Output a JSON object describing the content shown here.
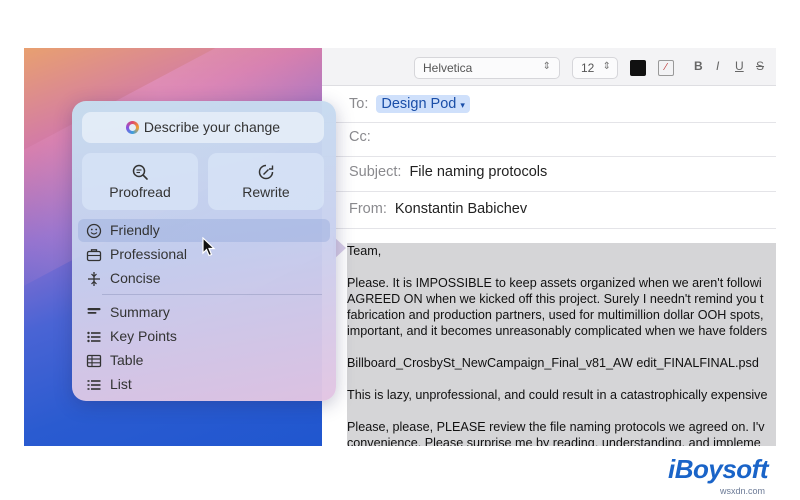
{
  "toolbar": {
    "font": "Helvetica",
    "size": "12",
    "bold": "B",
    "italic": "I",
    "underline": "U",
    "strike": "S",
    "text_color": "#111111"
  },
  "mail": {
    "to_label": "To:",
    "to_value": "Design Pod",
    "cc_label": "Cc:",
    "subject_label": "Subject:",
    "subject_value": "File naming protocols",
    "from_label": "From:",
    "from_value": "Konstantin Babichev",
    "body": [
      "Team,",
      "Please. It is IMPOSSIBLE to keep assets organized when we aren't followi",
      "AGREED ON when we kicked off this project. Surely I needn't remind you t",
      "fabrication and production partners, used for multimillion dollar OOH spots,",
      "important, and it becomes unreasonably complicated when we have folders",
      "Billboard_CrosbySt_NewCampaign_Final_v81_AW edit_FINALFINAL.psd",
      "This is lazy, unprofessional, and could result in a catastrophically expensive",
      "Please, please, PLEASE review the file naming protocols we agreed on. I'v",
      "convenience. Please surprise me by reading, understanding, and impleme"
    ]
  },
  "writing_tools": {
    "describe": "Describe your change",
    "proofread": "Proofread",
    "rewrite": "Rewrite",
    "tones": [
      {
        "label": "Friendly",
        "icon": "smiley-icon",
        "selected": true
      },
      {
        "label": "Professional",
        "icon": "briefcase-icon",
        "selected": false
      },
      {
        "label": "Concise",
        "icon": "concise-icon",
        "selected": false
      }
    ],
    "formats": [
      {
        "label": "Summary",
        "icon": "summary-icon"
      },
      {
        "label": "Key Points",
        "icon": "key-points-icon"
      },
      {
        "label": "Table",
        "icon": "table-icon"
      },
      {
        "label": "List",
        "icon": "list-icon"
      }
    ]
  },
  "watermark": {
    "brand": "iBoysoft",
    "site": "wsxdn.com"
  },
  "colors": {
    "accent": "#1a4ea8",
    "recipient_bg": "#cfe0fb",
    "brand": "#1a64c8"
  }
}
